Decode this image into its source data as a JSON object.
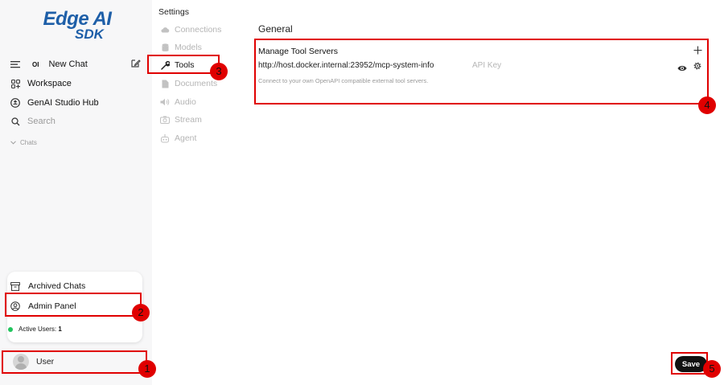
{
  "sidebar": {
    "logo_line1": "Edge AI",
    "logo_line2": "SDK",
    "new_chat": "New Chat",
    "new_chat_glyph": "OI",
    "workspace": "Workspace",
    "studio_hub": "GenAI Studio Hub",
    "search_placeholder": "Search",
    "chats_label": "Chats",
    "menu": {
      "archived_chats": "Archived Chats",
      "admin_panel": "Admin Panel",
      "active_users_label": "Active Users:",
      "active_users_count": "1"
    },
    "user_name": "User"
  },
  "settings": {
    "title": "Settings",
    "nav": [
      {
        "label": "Connections",
        "icon": "cloud-icon",
        "active": false
      },
      {
        "label": "Models",
        "icon": "database-icon",
        "active": false
      },
      {
        "label": "Tools",
        "icon": "wrench-icon",
        "active": true
      },
      {
        "label": "Documents",
        "icon": "document-icon",
        "active": false
      },
      {
        "label": "Audio",
        "icon": "speaker-icon",
        "active": false
      },
      {
        "label": "Stream",
        "icon": "camera-icon",
        "active": false
      },
      {
        "label": "Agent",
        "icon": "robot-icon",
        "active": false
      }
    ]
  },
  "main": {
    "section_title": "General",
    "tool_servers_heading": "Manage Tool Servers",
    "server_url": "http://host.docker.internal:23952/mcp-system-info",
    "api_key_placeholder": "API Key",
    "description": "Connect to your own OpenAPI compatible external tool servers.",
    "save_label": "Save"
  },
  "annotations": [
    "1",
    "2",
    "3",
    "4",
    "5"
  ],
  "colors": {
    "highlight": "#e00000",
    "brand": "#1e5fa8",
    "online": "#22c55e"
  }
}
